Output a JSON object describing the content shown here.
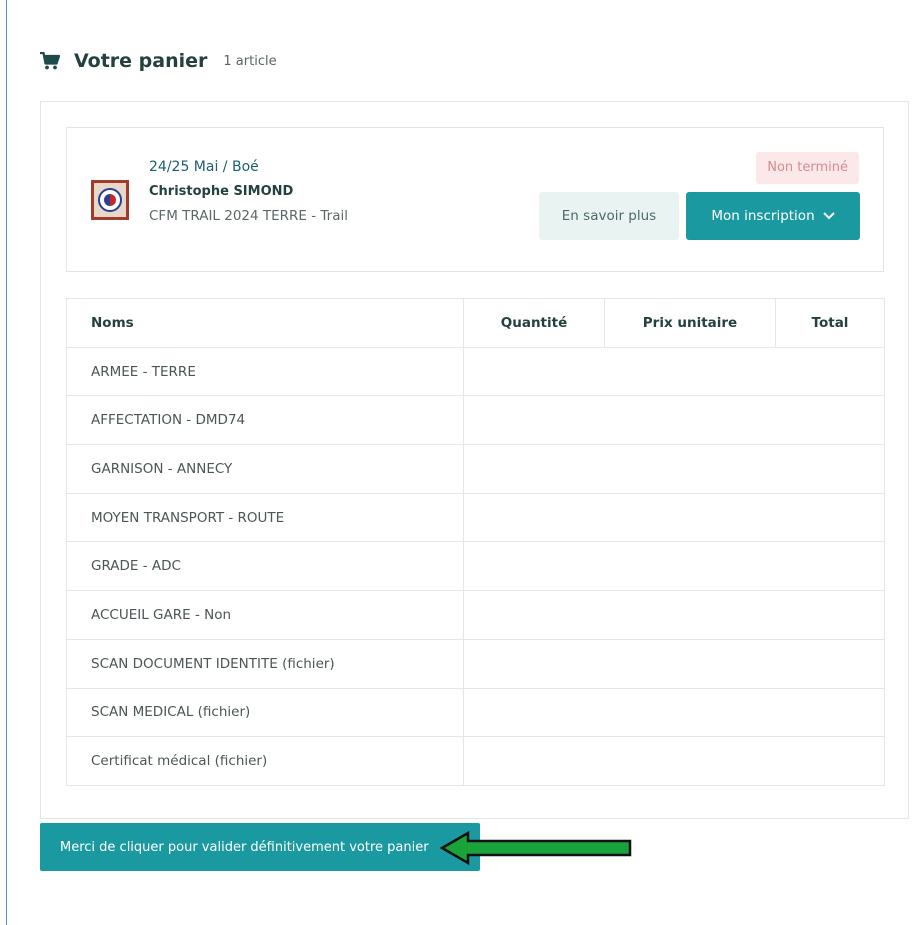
{
  "cart": {
    "title": "Votre panier",
    "count_label": "1 article"
  },
  "event": {
    "date_place": "24/25 Mai / Boé",
    "participant": "Christophe SIMOND",
    "race": "CFM TRAIL 2024 TERRE - Trail",
    "status": "Non terminé",
    "info_button": "En savoir plus",
    "registration_button": "Mon inscription"
  },
  "table": {
    "headers": {
      "name": "Noms",
      "quantity": "Quantité",
      "unit_price": "Prix unitaire",
      "total": "Total"
    },
    "rows": [
      "ARMEE - TERRE",
      "AFFECTATION - DMD74",
      "GARNISON - ANNECY",
      "MOYEN TRANSPORT - ROUTE",
      "GRADE - ADC",
      "ACCUEIL GARE - Non",
      "SCAN DOCUMENT IDENTITE (fichier)",
      "SCAN MEDICAL (fichier)",
      "Certificat médical (fichier)"
    ]
  },
  "validate_button": "Merci de cliquer pour valider définitivement votre panier",
  "colors": {
    "primary": "#1a9aa0",
    "status_bg": "#fbe9ea",
    "status_text": "#d98a8e",
    "annotation_arrow": "#1aa33a"
  },
  "icons": {
    "cart": "shopping-cart-icon",
    "dropdown": "chevron-down-icon",
    "event_logo": "event-logo",
    "annotation": "annotation-arrow"
  }
}
